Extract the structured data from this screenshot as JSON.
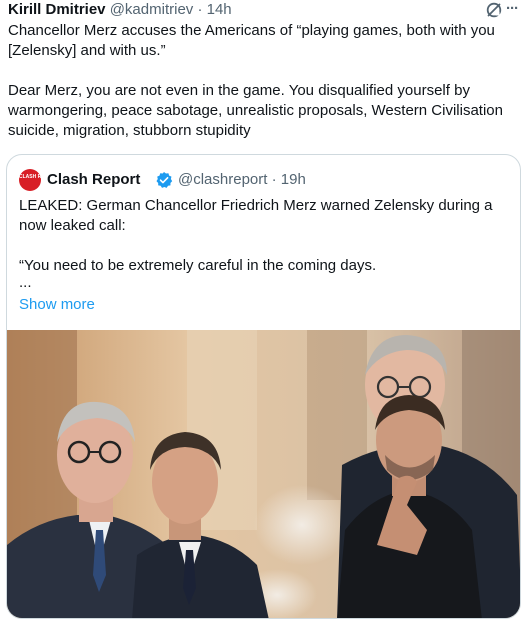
{
  "tweet": {
    "author_name": "Kirill Dmitriev",
    "author_handle": "@kadmitriev",
    "separator": " · ",
    "time": "14h",
    "icons": {
      "grok": "grok-icon",
      "more": "more-options-icon"
    },
    "more_glyph": "···",
    "lines_p1": [
      "Chancellor Merz accuses the Americans of “playing games, both with you",
      "[Zelensky] and with us.”"
    ],
    "lines_p2": [
      "Dear Merz, you are not even in the game. You disqualified yourself by",
      "warmongering, peace sabotage, unrealistic proposals, Western Civilisation",
      "suicide, migration, stubborn stupidity"
    ]
  },
  "quote": {
    "avatar_text": "CLASH REPORT",
    "author_name": "Clash Report",
    "verified_icon": "verified-badge-icon",
    "author_handle": "@clashreport",
    "separator": " · ",
    "time": "19h",
    "lines_p1": [
      "LEAKED: German Chancellor Friedrich Merz warned Zelensky during a",
      "now leaked call:"
    ],
    "lines_p2": [
      "“You need to be extremely careful in the coming days."
    ],
    "ellipsis": "...",
    "show_more": "Show more",
    "photo": "photo-of-four-leaders",
    "colors": {
      "link": "#1d9bf0",
      "verified": "#1d9bf0",
      "avatar": "#d81f26"
    }
  }
}
